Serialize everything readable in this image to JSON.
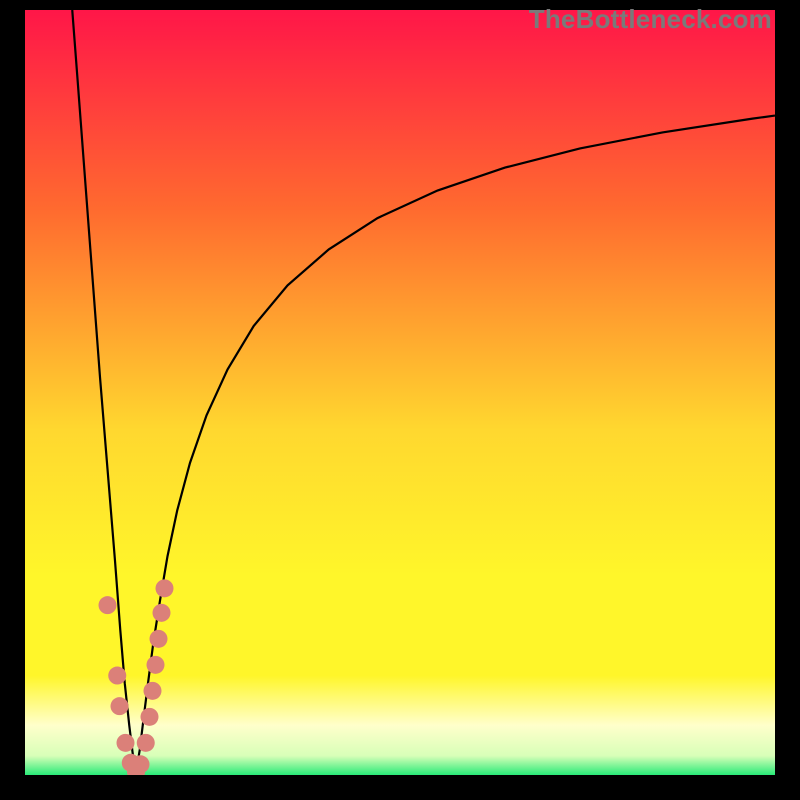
{
  "watermark": "TheBottleneck.com",
  "colors": {
    "gradient_top": "#ff1648",
    "gradient_mid1": "#ff6a2f",
    "gradient_mid2": "#ffd82f",
    "gradient_yellow": "#fff62a",
    "gradient_pale": "#ffffcb",
    "gradient_green": "#29ea78",
    "curve": "#000000",
    "marker": "#db8079",
    "frame": "#000000"
  },
  "chart_data": {
    "type": "line",
    "title": "",
    "xlabel": "",
    "ylabel": "",
    "xlim": [
      0,
      100
    ],
    "ylim": [
      0,
      100
    ],
    "grid": false,
    "legend": false,
    "series": [
      {
        "name": "left-branch",
        "x": [
          6.3,
          7.0,
          8.0,
          9.0,
          10.0,
          11.0,
          12.0,
          12.7,
          13.3,
          13.9,
          14.4,
          14.8
        ],
        "y": [
          100,
          91,
          78,
          65,
          52,
          40,
          28,
          19,
          12,
          6.5,
          2.5,
          0.3
        ]
      },
      {
        "name": "right-branch",
        "x": [
          14.8,
          15.3,
          15.8,
          16.4,
          17.1,
          18.0,
          19.0,
          20.3,
          22.0,
          24.2,
          27.0,
          30.5,
          35.0,
          40.5,
          47.0,
          55.0,
          64.0,
          74.0,
          85.0,
          97.0,
          100.0
        ],
        "y": [
          0.3,
          3.3,
          7.3,
          12.0,
          17.2,
          22.8,
          28.6,
          34.6,
          40.8,
          47.0,
          53.0,
          58.7,
          64.0,
          68.7,
          72.8,
          76.4,
          79.4,
          81.9,
          84.0,
          85.8,
          86.2
        ]
      }
    ],
    "markers": {
      "name": "datapoints",
      "points": [
        {
          "x": 11.0,
          "y": 22.2
        },
        {
          "x": 12.3,
          "y": 13.0
        },
        {
          "x": 12.6,
          "y": 9.0
        },
        {
          "x": 13.4,
          "y": 4.2
        },
        {
          "x": 14.1,
          "y": 1.6
        },
        {
          "x": 14.8,
          "y": 0.4
        },
        {
          "x": 15.4,
          "y": 1.4
        },
        {
          "x": 16.1,
          "y": 4.2
        },
        {
          "x": 16.6,
          "y": 7.6
        },
        {
          "x": 17.0,
          "y": 11.0
        },
        {
          "x": 17.4,
          "y": 14.4
        },
        {
          "x": 17.8,
          "y": 17.8
        },
        {
          "x": 18.2,
          "y": 21.2
        },
        {
          "x": 18.6,
          "y": 24.4
        }
      ]
    }
  }
}
